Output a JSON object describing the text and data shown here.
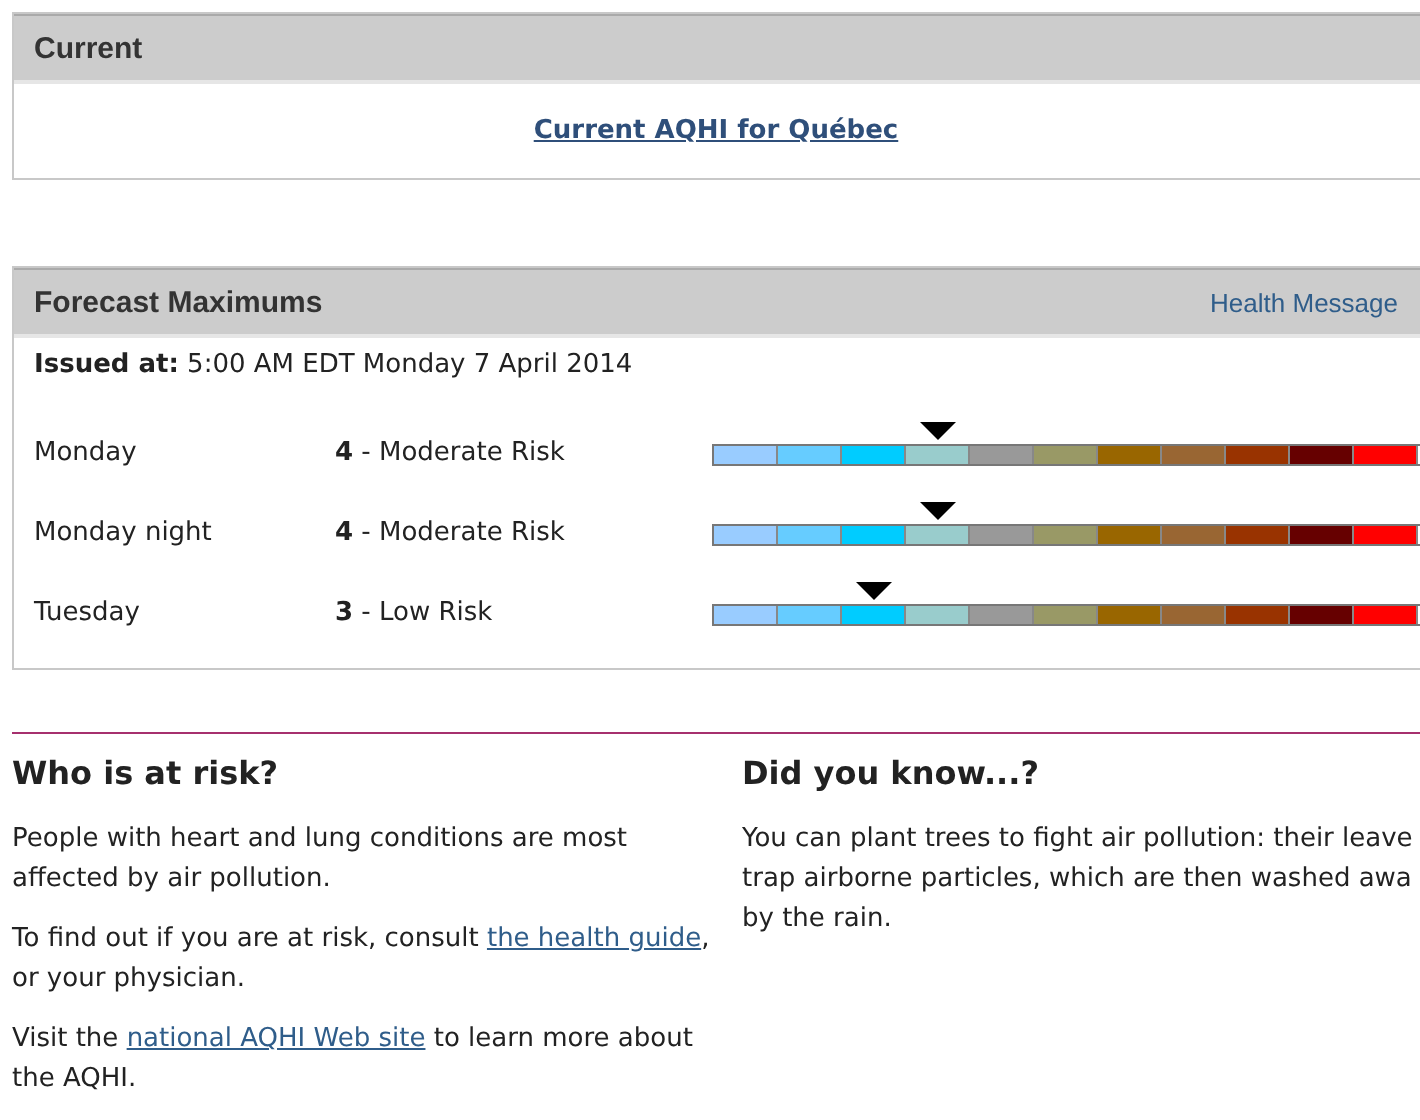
{
  "current": {
    "title": "Current",
    "link": "Current AQHI for Québec"
  },
  "forecast": {
    "title": "Forecast Maximums",
    "header_link": "Health Message",
    "issued_label": "Issued at:",
    "issued_value": "5:00 AM EDT Monday 7 April 2014",
    "scale": [
      {
        "color": "#99ccff"
      },
      {
        "color": "#66ccff"
      },
      {
        "color": "#00ccff"
      },
      {
        "color": "#99cccc"
      },
      {
        "color": "#999999"
      },
      {
        "color": "#999966"
      },
      {
        "color": "#996600"
      },
      {
        "color": "#996633"
      },
      {
        "color": "#993300"
      },
      {
        "color": "#660000"
      },
      {
        "color": "#ff0000"
      }
    ],
    "rows": [
      {
        "period": "Monday",
        "risk": "**4** - Moderate Risk",
        "level": 0.318
      },
      {
        "period": "Monday night",
        "risk": "**4** - Moderate Risk",
        "level": 0.318
      },
      {
        "period": "Tuesday",
        "risk": "**3** - Low Risk",
        "level": 0.227
      }
    ]
  },
  "who_at_risk": {
    "title": "Who is at risk?",
    "paragraphs": [
      [
        {
          "kind": "text",
          "text": "People with heart and lung conditions are most affected by air pollution."
        }
      ],
      [
        {
          "kind": "text",
          "text": "To find out if you are at risk, consult "
        },
        {
          "kind": "link",
          "text": "the health guide"
        },
        {
          "kind": "text",
          "text": ", or your physician."
        }
      ],
      [
        {
          "kind": "text",
          "text": "Visit the "
        },
        {
          "kind": "link",
          "text": "national AQHI Web site"
        },
        {
          "kind": "text",
          "text": " to learn more about the AQHI."
        }
      ]
    ]
  },
  "did_you_know": {
    "title": "Did you know...?",
    "lines": [
      "You can plant trees to fight air pollution: their leave",
      "trap airborne particles, which are then washed awa",
      "by the rain."
    ]
  }
}
